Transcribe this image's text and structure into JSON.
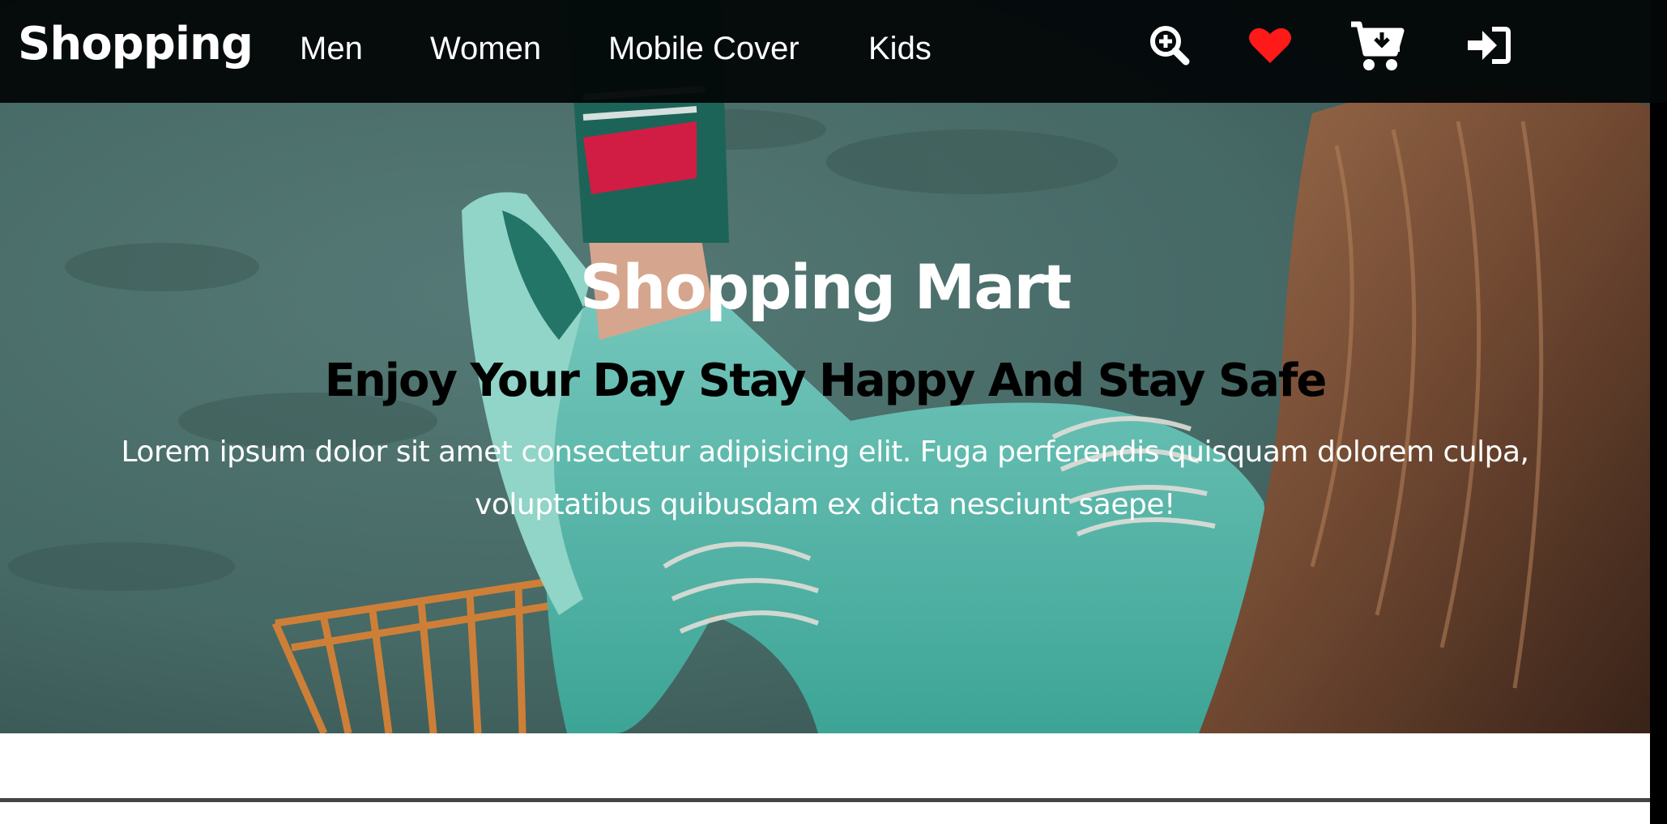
{
  "navbar": {
    "brand": "Shopping",
    "links": [
      {
        "label": "Men"
      },
      {
        "label": "Women"
      },
      {
        "label": "Mobile Cover"
      },
      {
        "label": "Kids"
      }
    ],
    "icons": [
      {
        "name": "zoom-in-icon"
      },
      {
        "name": "heart-icon"
      },
      {
        "name": "cart-download-icon"
      },
      {
        "name": "sign-in-icon"
      }
    ]
  },
  "hero": {
    "title": "Shopping Mart",
    "subtitle": "Enjoy Your Day Stay Happy And Stay Safe",
    "text": "Lorem ipsum dolor sit amet consectetur adipisicing elit. Fuga perferendis quisquam dolorem culpa, voluptatibus quibusdam ex dicta nesciunt saepe!"
  },
  "colors": {
    "navbar_bg": "#030708",
    "accent_heart": "#ff1a1a",
    "hero_title": "#ffffff",
    "hero_subtitle": "#000000"
  }
}
